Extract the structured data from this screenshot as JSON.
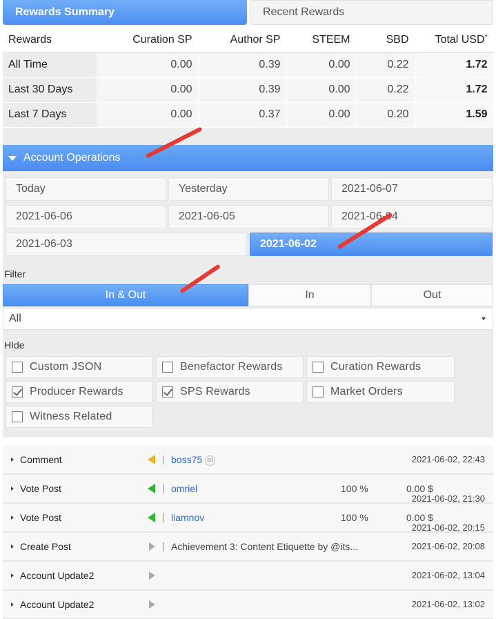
{
  "tabs": [
    {
      "label": "Rewards Summary",
      "active": true
    },
    {
      "label": "Recent Rewards",
      "active": false
    }
  ],
  "rewards": {
    "headers": [
      "Rewards",
      "Curation SP",
      "Author SP",
      "STEEM",
      "SBD",
      "Total USD"
    ],
    "usd_mark": "*",
    "rows": [
      [
        "All Time",
        "0.00",
        "0.39",
        "0.00",
        "0.22",
        "1.72"
      ],
      [
        "Last 30 Days",
        "0.00",
        "0.39",
        "0.00",
        "0.22",
        "1.72"
      ],
      [
        "Last 7 Days",
        "0.00",
        "0.37",
        "0.00",
        "0.20",
        "1.59"
      ]
    ]
  },
  "operations": {
    "header": "Account Operations",
    "days": [
      "Today",
      "Yesterday",
      "2021-06-07",
      "2021-06-06",
      "2021-06-05",
      "2021-06-04",
      "2021-06-03",
      "2021-06-02"
    ],
    "selected_day": "2021-06-02",
    "filter_label": "Filter",
    "filter_options": [
      "In & Out",
      "In",
      "Out"
    ],
    "filter_selected": "In & Out",
    "type_select": "All",
    "hide_label": "HIde",
    "hide_options": [
      {
        "label": "Custom JSON",
        "checked": false
      },
      {
        "label": "Benefactor Rewards",
        "checked": false
      },
      {
        "label": "Curation Rewards",
        "checked": false
      },
      {
        "label": "Producer Rewards",
        "checked": true
      },
      {
        "label": "SPS Rewards",
        "checked": true
      },
      {
        "label": "Market Orders",
        "checked": false
      },
      {
        "label": "Witness Related",
        "checked": false
      }
    ],
    "list": [
      {
        "type": "Comment",
        "direction": "out",
        "user": "boss75",
        "rep": "69",
        "desc": "",
        "pct": "",
        "amount": "",
        "time": "2021-06-02, 22:43"
      },
      {
        "type": "Vote Post",
        "direction": "in",
        "user": "omriel",
        "rep": "",
        "desc": "",
        "pct": "100 %",
        "amount": "0.00 $",
        "time": "2021-06-02, 21:30"
      },
      {
        "type": "Vote Post",
        "direction": "in",
        "user": "liamnov",
        "rep": "",
        "desc": "",
        "pct": "100 %",
        "amount": "0.00 $",
        "time": "2021-06-02, 20:15"
      },
      {
        "type": "Create Post",
        "direction": "neutral",
        "user": "",
        "rep": "",
        "desc": "Achievement 3: Content Etiquette by @its...",
        "pct": "",
        "amount": "",
        "time": "2021-06-02, 20:08"
      },
      {
        "type": "Account Update2",
        "direction": "neutral",
        "user": "",
        "rep": "",
        "desc": "",
        "pct": "",
        "amount": "",
        "time": "2021-06-02, 13:04"
      },
      {
        "type": "Account Update2",
        "direction": "neutral",
        "user": "",
        "rep": "",
        "desc": "",
        "pct": "",
        "amount": "",
        "time": "2021-06-02, 13:02"
      }
    ]
  },
  "colors": {
    "accent": "#4a8ef0",
    "annotation": "#e53935",
    "incoming": "#2eb82e",
    "outgoing": "#f0b429",
    "link": "#2a6bc7"
  }
}
